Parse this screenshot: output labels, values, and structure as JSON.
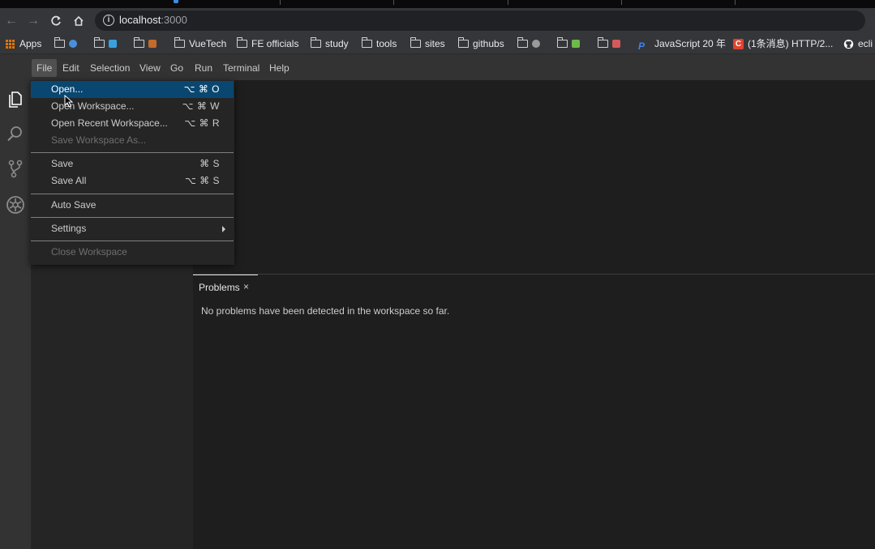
{
  "browser": {
    "url_host": "localhost",
    "url_port": ":3000",
    "bookmarks": [
      {
        "label": "Apps",
        "kind": "apps"
      },
      {
        "label": "",
        "kind": "folder",
        "favicon": "#4a90d9"
      },
      {
        "label": "",
        "kind": "folder",
        "favicon": "#3aa0e0"
      },
      {
        "label": "",
        "kind": "folder",
        "favicon": "#c46a2b"
      },
      {
        "label": "VueTech",
        "kind": "folder"
      },
      {
        "label": "FE officials",
        "kind": "folder"
      },
      {
        "label": "study",
        "kind": "folder"
      },
      {
        "label": "tools",
        "kind": "folder"
      },
      {
        "label": "sites",
        "kind": "folder"
      },
      {
        "label": "githubs",
        "kind": "folder"
      },
      {
        "label": "",
        "kind": "folder",
        "favicon": "#9a9a9a"
      },
      {
        "label": "",
        "kind": "folder",
        "favicon": "#6fb84a"
      },
      {
        "label": "",
        "kind": "folder",
        "favicon": "#d45a5a"
      },
      {
        "label": "JavaScript 20 年",
        "kind": "link",
        "favicon": "#3b82f6"
      },
      {
        "label": "(1条消息) HTTP/2...",
        "kind": "link",
        "favicon": "#e0432f"
      },
      {
        "label": "ecli",
        "kind": "link",
        "favicon": "#ffffff"
      }
    ]
  },
  "ide": {
    "menubar": [
      "File",
      "Edit",
      "Selection",
      "View",
      "Go",
      "Run",
      "Terminal",
      "Help"
    ],
    "file_menu": {
      "open": {
        "label": "Open...",
        "shortcut": "⌥ ⌘ O"
      },
      "open_workspace": {
        "label": "Open Workspace...",
        "shortcut": "⌥ ⌘ W"
      },
      "open_recent": {
        "label": "Open Recent Workspace...",
        "shortcut": "⌥ ⌘ R"
      },
      "save_workspace_as": {
        "label": "Save Workspace As..."
      },
      "save": {
        "label": "Save",
        "shortcut": "⌘ S"
      },
      "save_all": {
        "label": "Save All",
        "shortcut": "⌥ ⌘ S"
      },
      "auto_save": {
        "label": "Auto Save"
      },
      "settings": {
        "label": "Settings"
      },
      "close_workspace": {
        "label": "Close Workspace"
      }
    },
    "panel": {
      "tab_label": "Problems",
      "tab_close": "×",
      "message": "No problems have been detected in the workspace so far."
    }
  }
}
